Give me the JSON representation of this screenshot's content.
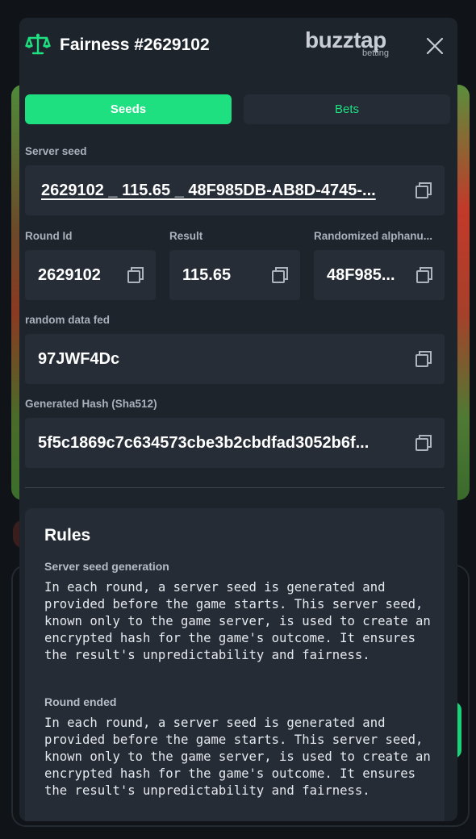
{
  "header": {
    "title": "Fairness #2629102",
    "brand_main": "buzztap",
    "brand_sub": "betting"
  },
  "tabs": [
    {
      "label": "Seeds",
      "active": true
    },
    {
      "label": "Bets",
      "active": false
    }
  ],
  "fields": {
    "server_seed": {
      "label": "Server seed",
      "value": "2629102 _ 115.65 _ 48F985DB-AB8D-4745-..."
    },
    "round_id": {
      "label": "Round Id",
      "value": "2629102"
    },
    "result": {
      "label": "Result",
      "value": "115.65"
    },
    "randomized": {
      "label": "Randomized alphanu...",
      "value": "48F985..."
    },
    "random_data": {
      "label": "random data fed",
      "value": "97JWF4Dc"
    },
    "generated_hash": {
      "label": "Generated Hash (Sha512)",
      "value": "5f5c1869c7c634573cbe3b2cbdfad3052b6f..."
    }
  },
  "rules": {
    "title": "Rules",
    "sections": [
      {
        "heading": "Server seed generation",
        "text": "In each round, a server seed is generated and provided before the game starts. This server seed, known only to the game server, is used to create an encrypted hash for the game's outcome. It ensures the result's unpredictability and fairness."
      },
      {
        "heading": "Round ended",
        "text": "In each round, a server seed is generated and provided before the game starts. This server seed, known only to the game server, is used to create an encrypted hash for the game's outcome. It ensures the result's unpredictability and fairness."
      }
    ]
  },
  "colors": {
    "accent": "#1fe081",
    "modal_bg": "#1e242c",
    "field_bg": "#262d36"
  },
  "icons": [
    "scale-icon",
    "close-icon",
    "copy-icon"
  ]
}
